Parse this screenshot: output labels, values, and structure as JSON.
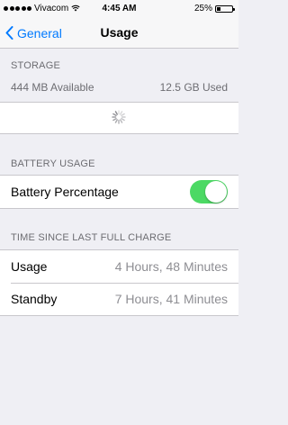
{
  "status_bar": {
    "carrier": "Vivacom",
    "time": "4:45 AM",
    "battery_text": "25%",
    "battery_level": 0.25
  },
  "nav": {
    "back_label": "General",
    "title": "Usage"
  },
  "storage": {
    "header": "STORAGE",
    "available": "444 MB Available",
    "used": "12.5 GB Used"
  },
  "battery_usage": {
    "header": "BATTERY USAGE",
    "battery_percentage_label": "Battery Percentage",
    "battery_percentage_on": true
  },
  "time_since_charge": {
    "header": "TIME SINCE LAST FULL CHARGE",
    "rows": [
      {
        "label": "Usage",
        "value": "4 Hours, 48 Minutes"
      },
      {
        "label": "Standby",
        "value": "7 Hours, 41 Minutes"
      }
    ]
  },
  "colors": {
    "accent": "#007aff",
    "toggle_on": "#4cd964",
    "background": "#efeff4"
  }
}
